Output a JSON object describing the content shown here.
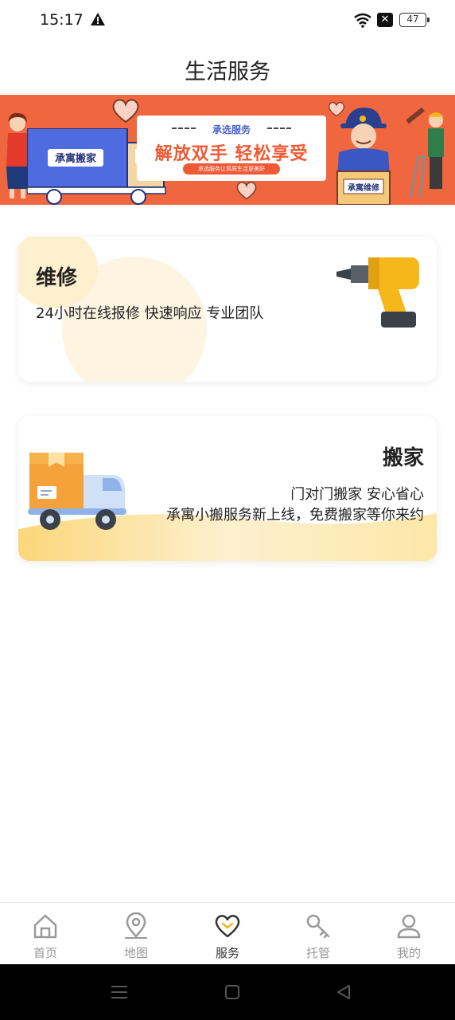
{
  "status": {
    "time": "15:17",
    "battery": "47"
  },
  "header": {
    "title": "生活服务"
  },
  "banner": {
    "subtitle": "承选服务",
    "slogan": "解放双手 轻松享受",
    "tagline": "承选服务让高质生活更美好",
    "truck_sign": "承寓搬家",
    "box_sign": "承寓维修"
  },
  "services": {
    "repair": {
      "title": "维修",
      "desc": "24小时在线报修 快速响应 专业团队"
    },
    "move": {
      "title": "搬家",
      "desc1": "门对门搬家 安心省心",
      "desc2": "承寓小搬服务新上线，免费搬家等你来约"
    }
  },
  "tabs": [
    {
      "label": "首页",
      "icon": "home-icon"
    },
    {
      "label": "地图",
      "icon": "map-pin-icon"
    },
    {
      "label": "服务",
      "icon": "heart-icon"
    },
    {
      "label": "托管",
      "icon": "key-icon"
    },
    {
      "label": "我的",
      "icon": "user-icon"
    }
  ],
  "active_tab": "服务",
  "colors": {
    "banner": "#f0663e",
    "accent": "#f3b81b",
    "card_bg": "#fdf5e2"
  }
}
